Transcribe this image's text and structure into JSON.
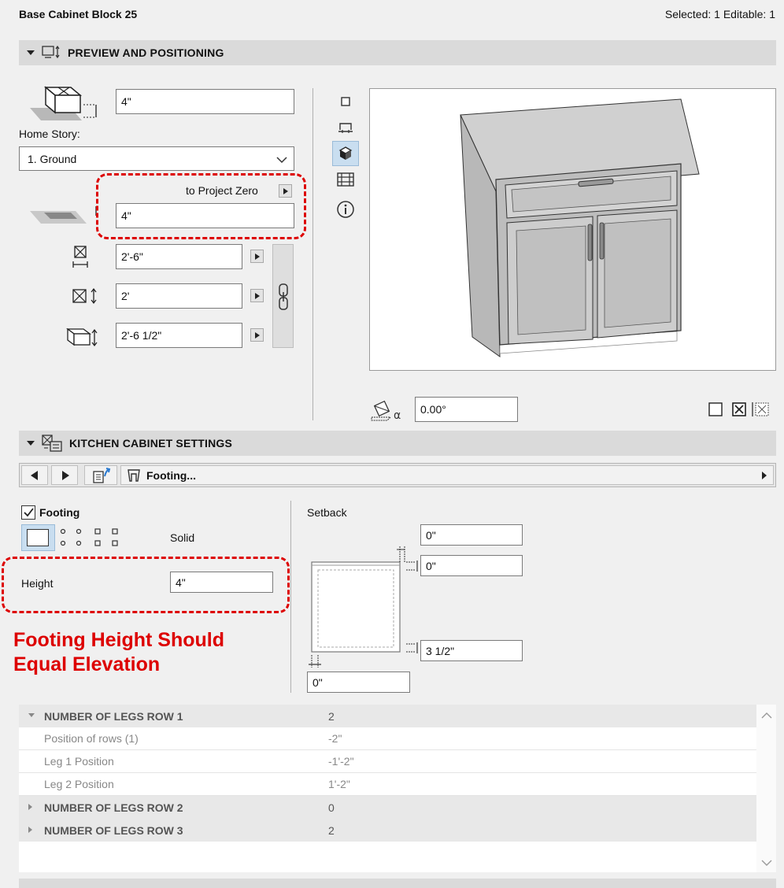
{
  "header": {
    "title": "Base Cabinet Block 25",
    "selection_status": "Selected: 1 Editable: 1"
  },
  "preview_section": {
    "title": "PREVIEW AND POSITIONING",
    "top_offset_value": "4\"",
    "home_story_label": "Home Story:",
    "home_story_value": "1. Ground",
    "reference_label": "to Project Zero",
    "elevation_value": "4\"",
    "width_value": "2'-6\"",
    "depth_value": "2'",
    "height_value": "2'-6 1/2\"",
    "rotation_value": "0.00°"
  },
  "kitchen_section": {
    "title": "KITCHEN CABINET SETTINGS",
    "page_label": "Footing...",
    "footing_label": "Footing",
    "footing_checked": true,
    "footing_type": "Solid",
    "height_label": "Height",
    "height_value": "4\"",
    "setback_label": "Setback",
    "setback_top": "0\"",
    "setback_right_top": "0\"",
    "setback_right_bottom": "3 1/2\"",
    "setback_bottom": "0\""
  },
  "annotation": {
    "line1": "Footing Height Should",
    "line2": "Equal Elevation",
    "color": "#dd0000"
  },
  "parameters": {
    "rows": [
      {
        "name": "NUMBER OF LEGS ROW 1",
        "value": "2"
      },
      {
        "name": "Position of rows (1)",
        "value": "-2\""
      },
      {
        "name": "Leg 1 Position",
        "value": "-1'-2\""
      },
      {
        "name": "Leg 2 Position",
        "value": "1'-2\""
      },
      {
        "name": "NUMBER OF LEGS ROW 2",
        "value": "0"
      },
      {
        "name": "NUMBER OF LEGS ROW 3",
        "value": "2"
      }
    ]
  },
  "icons": [
    "triangle-down-icon",
    "monitor-dimension-icon",
    "box-elevation-icon",
    "chevron-down-icon",
    "width-icon",
    "depth-icon",
    "height-icon",
    "chain-link-icon",
    "view-2d-icon",
    "view-section-icon",
    "view-3d-icon",
    "view-list-icon",
    "info-icon",
    "rotation-angle-icon",
    "mirror-none-icon",
    "mirror-x-icon",
    "mirror-y-icon",
    "prev-icon",
    "next-icon",
    "export-icon",
    "footing-icon",
    "scroll-up-icon",
    "scroll-down-icon"
  ]
}
